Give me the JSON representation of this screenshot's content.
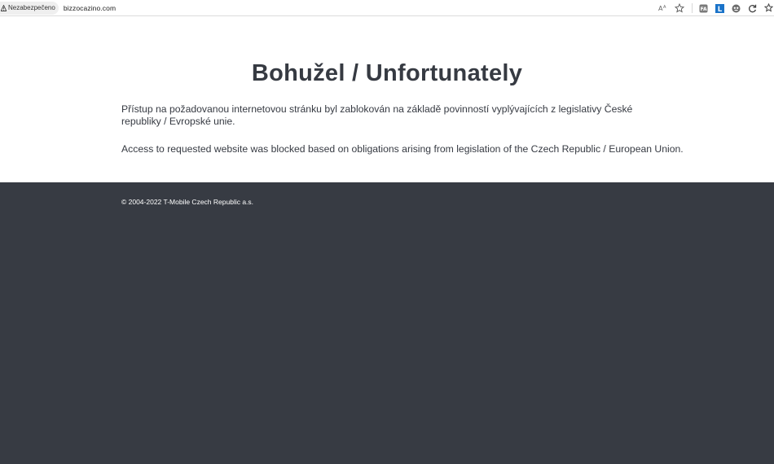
{
  "browser": {
    "security_label": "Nezabezpečeno",
    "url": "bizzocazino.com",
    "icons": [
      "warning-icon",
      "read-aloud-icon",
      "favorite-star-icon",
      "extension-icon",
      "extension-l-icon",
      "extension-owl-icon",
      "refresh-icon",
      "favorites-icon"
    ]
  },
  "page": {
    "title": "Bohužel / Unfortunately",
    "paragraph_cz": "Přístup na požadovanou internetovou stránku byl zablokován na základě povinností vyplývajících z legislativy České republiky / Evropské unie.",
    "paragraph_en": "Access to requested website was blocked based on obligations arising from legislation of the Czech Republic / European Union."
  },
  "footer": {
    "copyright": "© 2004-2022 T-Mobile Czech Republic a.s."
  },
  "colors": {
    "text": "#363a42",
    "footer_bg": "#373b43",
    "footer_text": "#ffffff",
    "extension_blue": "#1a73c9"
  }
}
